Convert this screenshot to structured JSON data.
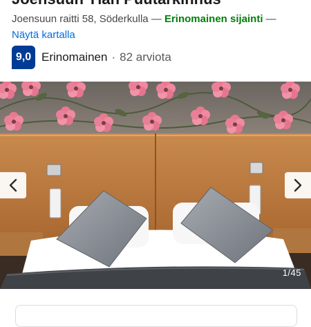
{
  "hotel": {
    "name_partial": "Joensuun Ylän Puutarkinnus"
  },
  "address": {
    "street": "Joensuun raitti 58, Söderkulla",
    "separator": " — ",
    "location_rating": "Erinomainen sijainti",
    "map_link": "Näytä kartalla"
  },
  "rating": {
    "score": "9,0",
    "label": "Erinomainen",
    "dot": "·",
    "reviews": "82 arviota"
  },
  "gallery": {
    "counter": "1/45",
    "prev_icon": "chevron-left-icon",
    "next_icon": "chevron-right-icon"
  },
  "colors": {
    "score_badge": "#003b95",
    "location_green": "#008009",
    "link_blue": "#006ce4"
  }
}
